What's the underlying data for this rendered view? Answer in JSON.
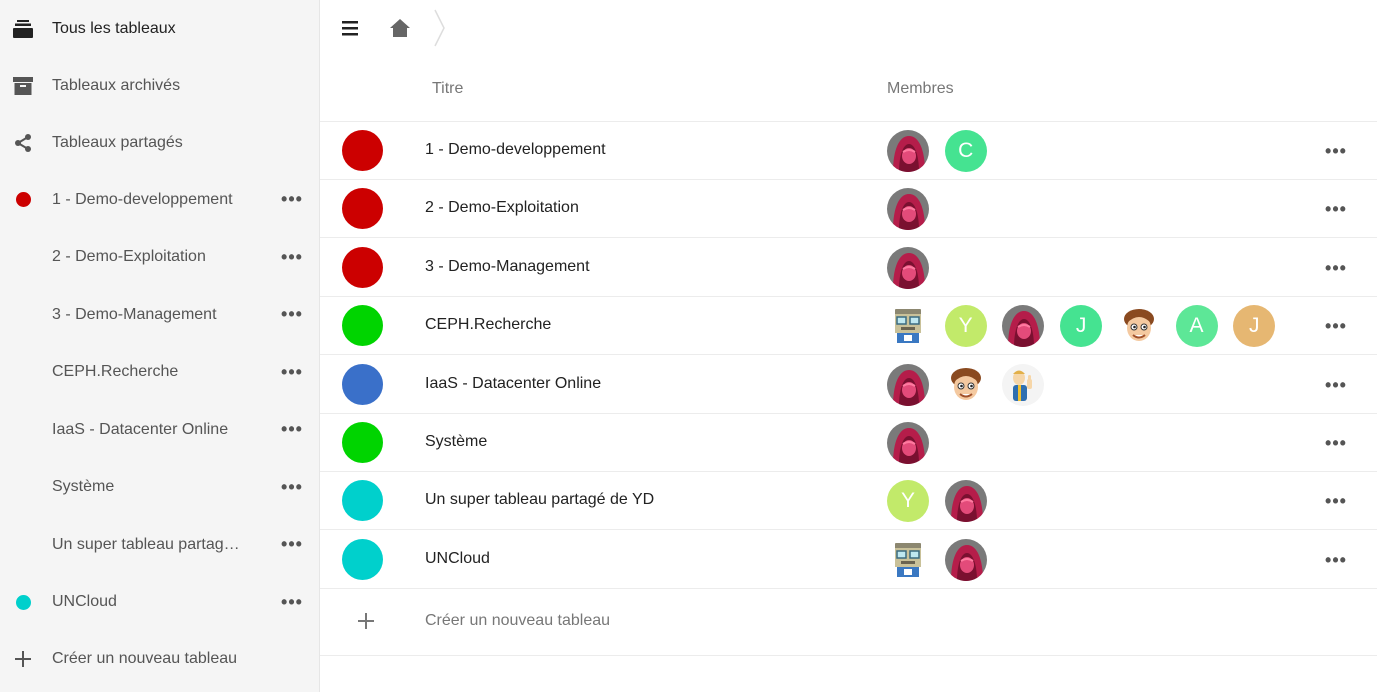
{
  "sidebar": {
    "all_boards": "Tous les tableaux",
    "archived": "Tableaux archivés",
    "shared": "Tableaux partagés",
    "boards": [
      {
        "label": "1 - Demo-developpement",
        "color": "#cc0000",
        "show_dot": true
      },
      {
        "label": "2 - Demo-Exploitation",
        "color": "#cc0000",
        "show_dot": false
      },
      {
        "label": "3 - Demo-Management",
        "color": "#cc0000",
        "show_dot": false
      },
      {
        "label": "CEPH.Recherche",
        "color": "#00d400",
        "show_dot": false
      },
      {
        "label": "IaaS - Datacenter Online",
        "color": "#3a70c9",
        "show_dot": false
      },
      {
        "label": "Système",
        "color": "#00d400",
        "show_dot": false
      },
      {
        "label": "Un super tableau partagé de YD",
        "color": "#00d0cc",
        "show_dot": false
      },
      {
        "label": "UNCloud",
        "color": "#00d0cc",
        "show_dot": true
      }
    ],
    "more_label": "•••",
    "create": "Créer un nouveau tableau"
  },
  "header": {
    "menu_icon": "hamburger-icon",
    "home_icon": "home-icon",
    "separator_icon": "breadcrumb-chevron-icon"
  },
  "table": {
    "col_title": "Titre",
    "col_members": "Membres",
    "rows": [
      {
        "title": "1 - Demo-developpement",
        "color": "#cc0000",
        "members": [
          {
            "type": "hood"
          },
          {
            "type": "letter",
            "letter": "C",
            "bg": "#45e391"
          }
        ]
      },
      {
        "title": "2 - Demo-Exploitation",
        "color": "#cc0000",
        "members": [
          {
            "type": "hood"
          }
        ]
      },
      {
        "title": "3 - Demo-Management",
        "color": "#cc0000",
        "members": [
          {
            "type": "hood"
          }
        ]
      },
      {
        "title": "CEPH.Recherche",
        "color": "#00d400",
        "members": [
          {
            "type": "robot"
          },
          {
            "type": "letter",
            "letter": "Y",
            "bg": "#c2ea6a"
          },
          {
            "type": "hood"
          },
          {
            "type": "letter",
            "letter": "J",
            "bg": "#45e391"
          },
          {
            "type": "face"
          },
          {
            "type": "letter",
            "letter": "A",
            "bg": "#5de797"
          },
          {
            "type": "letter",
            "letter": "J",
            "bg": "#e6b772"
          }
        ]
      },
      {
        "title": "IaaS - Datacenter Online",
        "color": "#3a70c9",
        "members": [
          {
            "type": "hood"
          },
          {
            "type": "face"
          },
          {
            "type": "vault"
          }
        ]
      },
      {
        "title": "Système",
        "color": "#00d400",
        "members": [
          {
            "type": "hood"
          }
        ]
      },
      {
        "title": "Un super tableau partagé de YD",
        "color": "#00d0cc",
        "members": [
          {
            "type": "letter",
            "letter": "Y",
            "bg": "#c2ea6a"
          },
          {
            "type": "hood"
          }
        ]
      },
      {
        "title": "UNCloud",
        "color": "#00d0cc",
        "members": [
          {
            "type": "robot"
          },
          {
            "type": "hood"
          }
        ]
      }
    ],
    "more_label": "•••",
    "create": "Créer un nouveau tableau"
  }
}
